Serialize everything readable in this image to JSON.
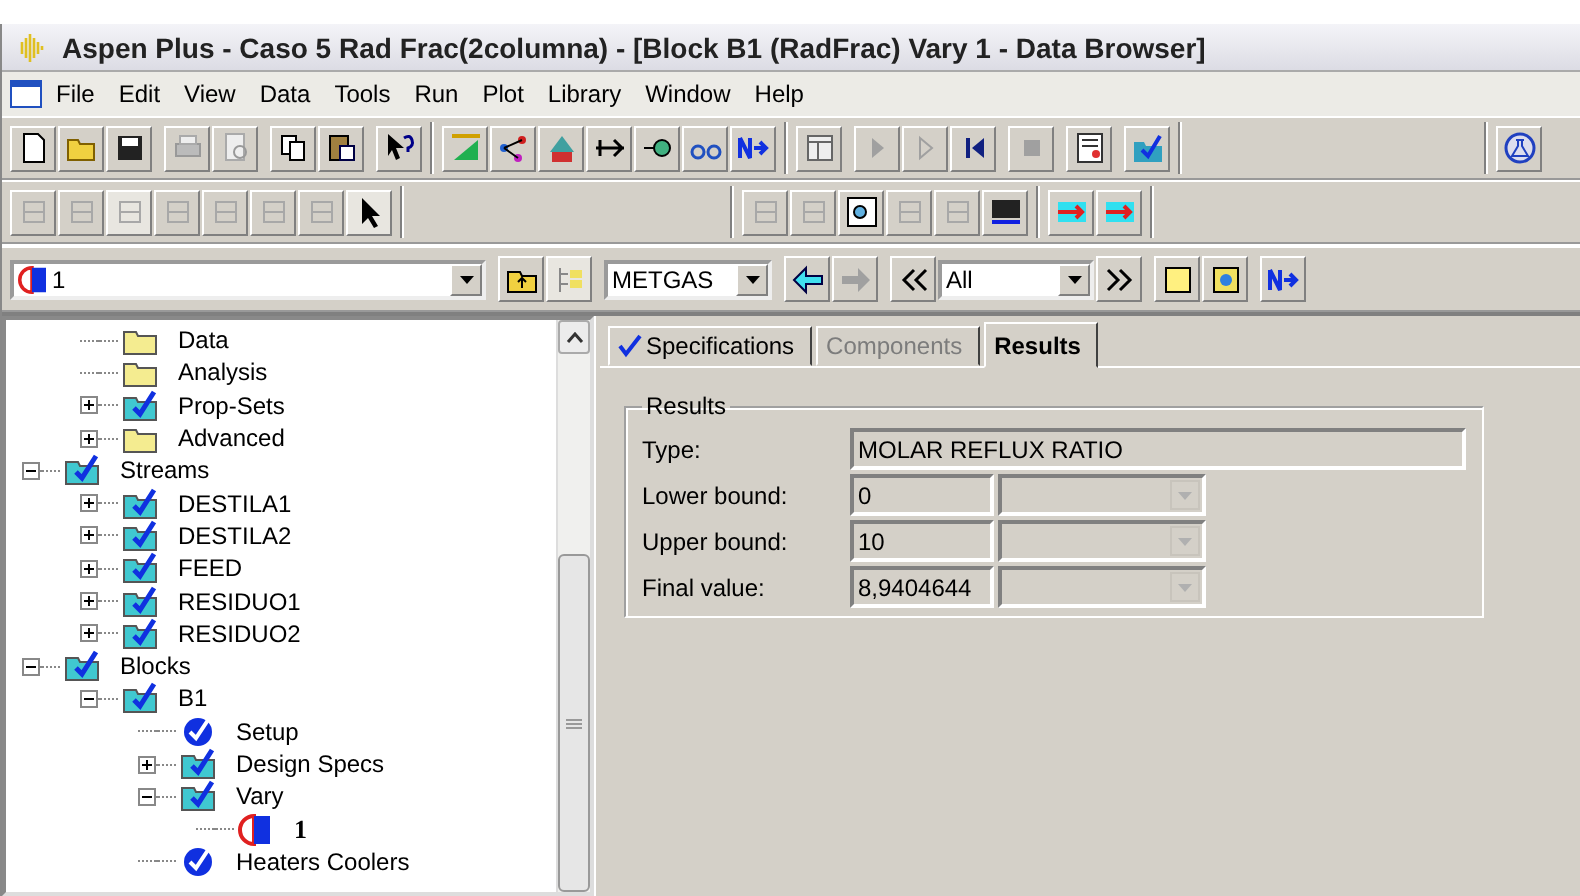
{
  "window": {
    "title": "Aspen Plus - Caso 5 Rad Frac(2columna) - [Block B1 (RadFrac) Vary 1 - Data Browser]"
  },
  "menu": [
    "File",
    "Edit",
    "View",
    "Data",
    "Tools",
    "Run",
    "Plot",
    "Library",
    "Window",
    "Help"
  ],
  "navigation": {
    "object": "1",
    "component": "METGAS",
    "filter": "All"
  },
  "tree": {
    "continued_items": [
      {
        "label": "Data",
        "kind": "folder",
        "complete": false
      },
      {
        "label": "Analysis",
        "kind": "folder",
        "complete": false
      },
      {
        "label": "Prop-Sets",
        "kind": "folder",
        "complete": true,
        "expanded": false
      },
      {
        "label": "Advanced",
        "kind": "folder",
        "complete": false,
        "expanded": false
      }
    ],
    "items": [
      {
        "label": "Streams",
        "kind": "folder",
        "complete": true,
        "expanded": true,
        "children": [
          {
            "label": "DESTILA1",
            "kind": "folder",
            "complete": true,
            "expanded": false
          },
          {
            "label": "DESTILA2",
            "kind": "folder",
            "complete": true,
            "expanded": false
          },
          {
            "label": "FEED",
            "kind": "folder",
            "complete": true,
            "expanded": false
          },
          {
            "label": "RESIDUO1",
            "kind": "folder",
            "complete": true,
            "expanded": false
          },
          {
            "label": "RESIDUO2",
            "kind": "folder",
            "complete": true,
            "expanded": false
          }
        ]
      },
      {
        "label": "Blocks",
        "kind": "folder",
        "complete": true,
        "expanded": true,
        "children": [
          {
            "label": "B1",
            "kind": "folder",
            "complete": true,
            "expanded": true,
            "children": [
              {
                "label": "Setup",
                "kind": "form",
                "complete": true
              },
              {
                "label": "Design Specs",
                "kind": "folder",
                "complete": true,
                "expanded": false
              },
              {
                "label": "Vary",
                "kind": "folder",
                "complete": true,
                "expanded": true,
                "children": [
                  {
                    "label": "1",
                    "kind": "sheet",
                    "selected": true
                  }
                ]
              },
              {
                "label": "Heaters Coolers",
                "kind": "form",
                "complete": true
              }
            ]
          }
        ]
      }
    ]
  },
  "tabs": [
    {
      "label": "Specifications",
      "selected": false,
      "disabled": false,
      "complete": true
    },
    {
      "label": "Components",
      "selected": false,
      "disabled": true,
      "complete": false
    },
    {
      "label": "Results",
      "selected": true,
      "disabled": false,
      "complete": false
    }
  ],
  "results": {
    "title": "Results",
    "type_label": "Type:",
    "type_value": "MOLAR REFLUX RATIO",
    "rows": [
      {
        "label": "Lower bound:",
        "value": "0"
      },
      {
        "label": "Upper bound:",
        "value": "10"
      },
      {
        "label": "Final value:",
        "value": "8,9404644"
      }
    ]
  }
}
